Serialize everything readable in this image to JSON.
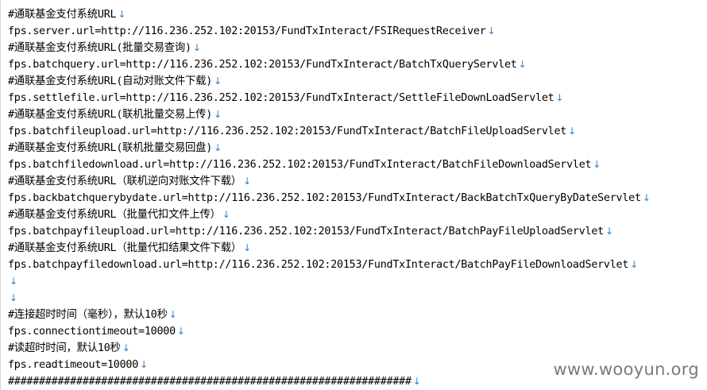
{
  "editor": {
    "paragraph_mark": "↓",
    "lines": [
      "#通联基金支付系统URL",
      "fps.server.url=http://116.236.252.102:20153/FundTxInteract/FSIRequestReceiver",
      "#通联基金支付系统URL(批量交易查询)",
      "fps.batchquery.url=http://116.236.252.102:20153/FundTxInteract/BatchTxQueryServlet",
      "#通联基金支付系统URL(自动对账文件下载)",
      "fps.settlefile.url=http://116.236.252.102:20153/FundTxInteract/SettleFileDownLoadServlet",
      "#通联基金支付系统URL(联机批量交易上传)",
      "fps.batchfileupload.url=http://116.236.252.102:20153/FundTxInteract/BatchFileUploadServlet",
      "#通联基金支付系统URL(联机批量交易回盘)",
      "fps.batchfiledownload.url=http://116.236.252.102:20153/FundTxInteract/BatchFileDownloadServlet",
      "#通联基金支付系统URL（联机逆向对账文件下载）",
      "fps.backbatchquerybydate.url=http://116.236.252.102:20153/FundTxInteract/BackBatchTxQueryByDateServlet",
      "#通联基金支付系统URL（批量代扣文件上传）",
      "fps.batchpayfileupload.url=http://116.236.252.102:20153/FundTxInteract/BatchPayFileUploadServlet",
      "#通联基金支付系统URL（批量代扣结果文件下载）",
      "fps.batchpayfiledownload.url=http://116.236.252.102:20153/FundTxInteract/BatchPayFileDownloadServlet",
      "",
      "",
      "#连接超时时间（毫秒），默认10秒",
      "fps.connectiontimeout=10000",
      "#读超时时间，默认10秒",
      "fps.readtimeout=10000",
      "#################################################################"
    ]
  },
  "watermark": {
    "text": "www.wooyun.org"
  }
}
